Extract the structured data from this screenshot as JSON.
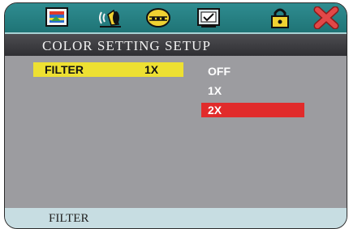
{
  "toolbar": {
    "icons": [
      "picture-setup-icon",
      "audio-setup-icon",
      "disc-setup-icon",
      "preference-setup-icon",
      "password-lock-icon",
      "exit-icon"
    ]
  },
  "header": {
    "title": "COLOR SETTING SETUP"
  },
  "menu": {
    "filter": {
      "label": "FILTER",
      "value": "1X"
    },
    "options": [
      {
        "label": "OFF",
        "selected": false
      },
      {
        "label": "1X",
        "selected": false
      },
      {
        "label": "2X",
        "selected": true
      }
    ]
  },
  "status": {
    "text": "FILTER"
  },
  "colors": {
    "toolbar": "#2a8387",
    "highlight": "#ede032",
    "selection": "#e12b2b",
    "panel": "#9c9ca0"
  }
}
